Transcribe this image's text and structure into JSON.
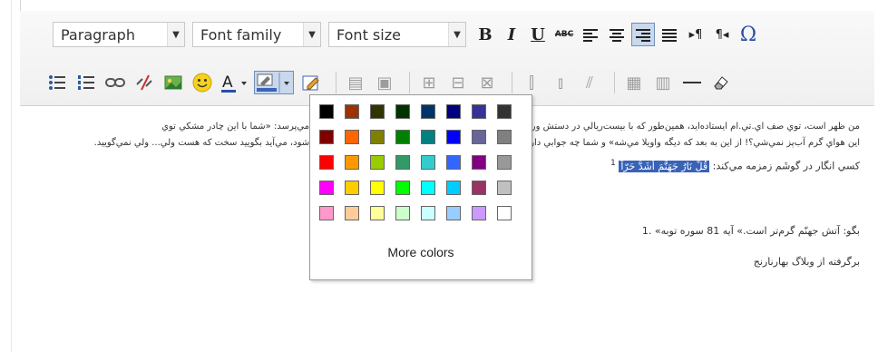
{
  "toolbar": {
    "format_select": "Paragraph",
    "font_family_select": "Font family",
    "font_size_select": "Font size",
    "buttons": {
      "bold": "B",
      "italic": "I",
      "underline": "U",
      "strike": "ABC",
      "omega": "Ω"
    }
  },
  "color_picker": {
    "more_colors": "More colors",
    "swatches": [
      [
        "#000000",
        "#993300",
        "#333300",
        "#003300",
        "#003366",
        "#000080",
        "#333399",
        "#333333"
      ],
      [
        "#800000",
        "#FF6600",
        "#808000",
        "#008000",
        "#008080",
        "#0000FF",
        "#666699",
        "#808080"
      ],
      [
        "#FF0000",
        "#FF9900",
        "#99CC00",
        "#339966",
        "#33CCCC",
        "#3366FF",
        "#800080",
        "#999999"
      ],
      [
        "#FF00FF",
        "#FFCC00",
        "#FFFF00",
        "#00FF00",
        "#00FFFF",
        "#00CCFF",
        "#993366",
        "#C0C0C0"
      ],
      [
        "#FF99CC",
        "#FFCC99",
        "#FFFF99",
        "#CCFFCC",
        "#CCFFFF",
        "#99CCFF",
        "#CC99FF",
        "#FFFFFF"
      ]
    ]
  },
  "content": {
    "line1": "من ظهر است، توي صف اي.تي.ام ايستاده‌ايد، همين‌طور كه با بيست‌ريالي در دستش ور مي‌رود، لحظه‌اي سرش را بالا مي‌آورد و با لحني ترحّم‌آميز مي‌پرسد: «شما با اين چادر مشكي توي",
    "line2": "اين هواي گرم آب‌پز نمي‌شي؟! از اين به بعد كه ديگه واويلا مي‌شه» و شما چه جوابي داريد؟! مي‌دانيد اگر جوابش را بگوييد كه دوباره نيشش باز مي‌شود، مي‌آيد بگوييد سخت كه هست ولي... ولي نمي‌گوييد.",
    "line3_prefix": "كسي انگار در گوشَم زمزمه مي‌كند:",
    "line3_highlight": "قُلْ نَارُ جَهَنَّمَ أَشَدُّ حَرّاً",
    "line3_mark": "1",
    "footnote": "بگو: آتش جهنّم گرم‌تر است.» آيه 81 سوره توبه» .1",
    "source": "برگرفته از وبلاگ بهارنارنج"
  }
}
